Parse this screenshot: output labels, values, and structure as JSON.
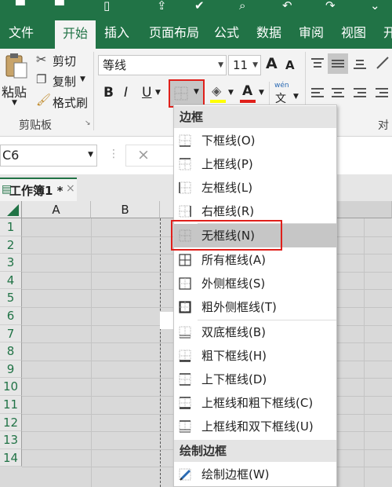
{
  "ribbon_tabs": [
    "文件",
    "开始",
    "插入",
    "页面布局",
    "公式",
    "数据",
    "审阅",
    "视图",
    "开"
  ],
  "clipboard": {
    "paste": "粘贴",
    "cut": "剪切",
    "copy": "复制",
    "format_painter": "格式刷",
    "group": "剪贴板"
  },
  "font": {
    "name": "等线",
    "size": "11",
    "bold": "B",
    "italic": "I",
    "underline": "U",
    "grow": "A",
    "shrink": "A",
    "font_color": "A",
    "pinyin_top": "wén",
    "pinyin_bottom": "文"
  },
  "align_group_partial": "对",
  "formula_bar": {
    "name_box": "C6",
    "cancel": "×",
    "enter": "✓",
    "fx": "fx"
  },
  "workbook_tab": "工作簿1 *",
  "workbook_close": "×",
  "grid": {
    "columns": [
      "A",
      "B"
    ],
    "rows": [
      "1",
      "2",
      "3",
      "4",
      "5",
      "6",
      "7",
      "8",
      "9",
      "10",
      "11",
      "12",
      "13",
      "14"
    ]
  },
  "border_menu": {
    "header_borders": "边框",
    "items": [
      {
        "label": "下框线(O)",
        "icon": "bottom-border-icon"
      },
      {
        "label": "上框线(P)",
        "icon": "top-border-icon"
      },
      {
        "label": "左框线(L)",
        "icon": "left-border-icon"
      },
      {
        "label": "右框线(R)",
        "icon": "right-border-icon"
      },
      {
        "label": "无框线(N)",
        "icon": "no-border-icon",
        "selected": true
      },
      {
        "label": "所有框线(A)",
        "icon": "all-borders-icon"
      },
      {
        "label": "外侧框线(S)",
        "icon": "outside-borders-icon"
      },
      {
        "label": "粗外侧框线(T)",
        "icon": "thick-outside-borders-icon"
      },
      {
        "label": "双底框线(B)",
        "icon": "bottom-double-border-icon"
      },
      {
        "label": "粗下框线(H)",
        "icon": "thick-bottom-border-icon"
      },
      {
        "label": "上下框线(D)",
        "icon": "top-bottom-border-icon"
      },
      {
        "label": "上框线和粗下框线(C)",
        "icon": "top-thick-bottom-border-icon"
      },
      {
        "label": "上框线和双下框线(U)",
        "icon": "top-double-bottom-border-icon"
      }
    ],
    "header_draw": "绘制边框",
    "draw_item": "绘制边框(W)"
  },
  "colors": {
    "excel_green": "#217346",
    "highlight_red": "#e0201b",
    "selected_item": "#c6c6c6"
  }
}
